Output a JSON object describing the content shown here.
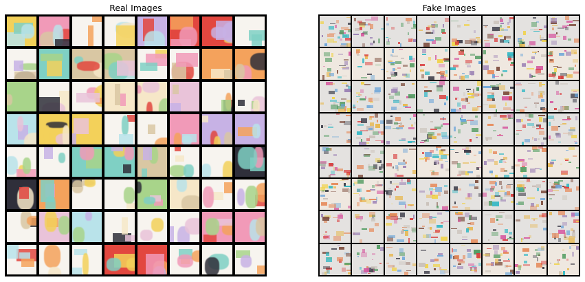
{
  "panels": {
    "left_title": "Real Images",
    "right_title": "Fake Images"
  },
  "grid": {
    "rows": 8,
    "cols": 8
  },
  "real_palette": [
    "#e9c3d9",
    "#b9e3ea",
    "#f3d15a",
    "#f19ab8",
    "#c7b2e5",
    "#e2473f",
    "#7fd0c4",
    "#d9c7a3",
    "#2f2f3a",
    "#f4a25c",
    "#a8d48a",
    "#f6e7c8"
  ],
  "fake_palette": [
    "#d65aa0",
    "#2fb7c4",
    "#e7b64a",
    "#7b4a3a",
    "#3a3a46",
    "#d93c3c",
    "#6aa4d8",
    "#c9c0b8",
    "#9a7fb4",
    "#e68a5a",
    "#4e9a5e",
    "#f0d24a"
  ],
  "colors": {
    "border": "#000000",
    "background": "#ffffff"
  }
}
